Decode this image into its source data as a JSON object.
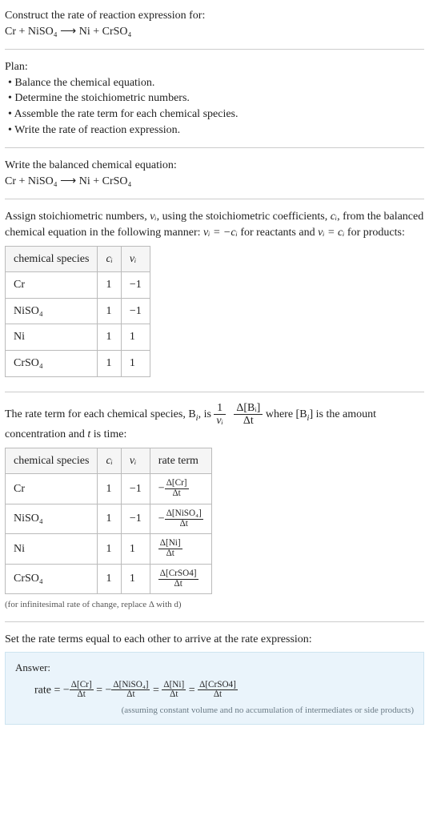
{
  "intro": {
    "construct_line": "Construct the rate of reaction expression for:",
    "equation": "Cr + NiSO₄  ⟶  Ni + CrSO₄"
  },
  "plan": {
    "title": "Plan:",
    "items": [
      "• Balance the chemical equation.",
      "• Determine the stoichiometric numbers.",
      "• Assemble the rate term for each chemical species.",
      "• Write the rate of reaction expression."
    ]
  },
  "balanced": {
    "title": "Write the balanced chemical equation:",
    "equation": "Cr + NiSO₄  ⟶  Ni + CrSO₄"
  },
  "stoich": {
    "desc_prefix": "Assign stoichiometric numbers, ",
    "nu_i": "νᵢ",
    "desc_mid1": ", using the stoichiometric coefficients, ",
    "c_i": "cᵢ",
    "desc_mid2": ", from the balanced chemical equation in the following manner: ",
    "rule1": "νᵢ = −cᵢ",
    "desc_mid3": " for reactants and ",
    "rule2": "νᵢ = cᵢ",
    "desc_end": " for products:",
    "headers": {
      "species": "chemical species",
      "ci": "cᵢ",
      "nui": "νᵢ"
    },
    "rows": [
      {
        "species": "Cr",
        "ci": "1",
        "nui": "−1"
      },
      {
        "species": "NiSO₄",
        "ci": "1",
        "nui": "−1"
      },
      {
        "species": "Ni",
        "ci": "1",
        "nui": "1"
      },
      {
        "species": "CrSO₄",
        "ci": "1",
        "nui": "1"
      }
    ]
  },
  "rate_terms": {
    "desc_prefix": "The rate term for each chemical species, B",
    "desc_sub": "i",
    "desc_mid": ", is ",
    "frac1_num": "1",
    "frac1_den": "νᵢ",
    "frac2_num": "Δ[Bᵢ]",
    "frac2_den": "Δt",
    "desc_where": " where [B",
    "desc_where2": "] is the amount concentration and ",
    "t_var": "t",
    "desc_end": " is time:",
    "headers": {
      "species": "chemical species",
      "ci": "cᵢ",
      "nui": "νᵢ",
      "rate": "rate term"
    },
    "rows": [
      {
        "species": "Cr",
        "ci": "1",
        "nui": "−1",
        "sign": "−",
        "num": "Δ[Cr]",
        "den": "Δt"
      },
      {
        "species": "NiSO₄",
        "ci": "1",
        "nui": "−1",
        "sign": "−",
        "num": "Δ[NiSO₄]",
        "den": "Δt"
      },
      {
        "species": "Ni",
        "ci": "1",
        "nui": "1",
        "sign": "",
        "num": "Δ[Ni]",
        "den": "Δt"
      },
      {
        "species": "CrSO₄",
        "ci": "1",
        "nui": "1",
        "sign": "",
        "num": "Δ[CrSO4]",
        "den": "Δt"
      }
    ],
    "footnote": "(for infinitesimal rate of change, replace Δ with d)"
  },
  "final": {
    "intro": "Set the rate terms equal to each other to arrive at the rate expression:",
    "answer_label": "Answer:",
    "rate_word": "rate = −",
    "t1_num": "Δ[Cr]",
    "t1_den": "Δt",
    "eq1": " = −",
    "t2_num": "Δ[NiSO₄]",
    "t2_den": "Δt",
    "eq2": " = ",
    "t3_num": "Δ[Ni]",
    "t3_den": "Δt",
    "eq3": " = ",
    "t4_num": "Δ[CrSO4]",
    "t4_den": "Δt",
    "note": "(assuming constant volume and no accumulation of intermediates or side products)"
  },
  "chart_data": {
    "type": "table",
    "title": "Stoichiometric numbers and rate terms",
    "tables": [
      {
        "columns": [
          "chemical species",
          "cᵢ",
          "νᵢ"
        ],
        "rows": [
          [
            "Cr",
            1,
            -1
          ],
          [
            "NiSO₄",
            1,
            -1
          ],
          [
            "Ni",
            1,
            1
          ],
          [
            "CrSO₄",
            1,
            1
          ]
        ]
      },
      {
        "columns": [
          "chemical species",
          "cᵢ",
          "νᵢ",
          "rate term"
        ],
        "rows": [
          [
            "Cr",
            1,
            -1,
            "−Δ[Cr]/Δt"
          ],
          [
            "NiSO₄",
            1,
            -1,
            "−Δ[NiSO₄]/Δt"
          ],
          [
            "Ni",
            1,
            1,
            "Δ[Ni]/Δt"
          ],
          [
            "CrSO₄",
            1,
            1,
            "Δ[CrSO4]/Δt"
          ]
        ]
      }
    ]
  }
}
